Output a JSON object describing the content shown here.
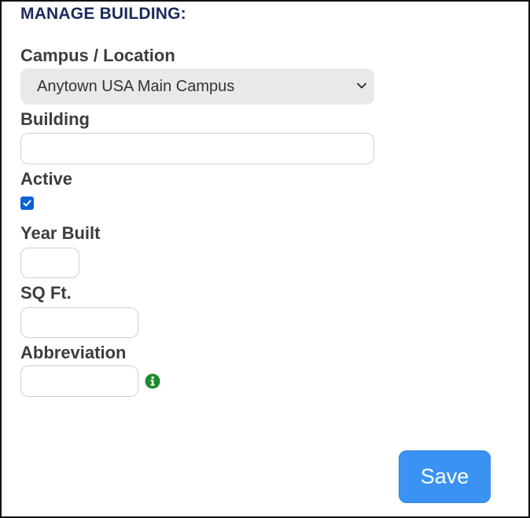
{
  "page": {
    "title": "MANAGE BUILDING:"
  },
  "form": {
    "campus_label": "Campus / Location",
    "campus_value": "Anytown USA Main Campus",
    "building_label": "Building",
    "building_value": "",
    "active_label": "Active",
    "active_checked": true,
    "year_built_label": "Year Built",
    "year_built_value": "",
    "sqft_label": "SQ Ft.",
    "sqft_value": "",
    "abbreviation_label": "Abbreviation",
    "abbreviation_value": "",
    "abbreviation_info_icon": "info-circle-icon",
    "save_label": "Save"
  },
  "colors": {
    "title": "#1b2a5c",
    "label": "#3d3d3d",
    "select_bg": "#e9e9e9",
    "checkbox_accent": "#0a62d8",
    "info_icon": "#1f8a2e",
    "save_button": "#3a93f3"
  }
}
